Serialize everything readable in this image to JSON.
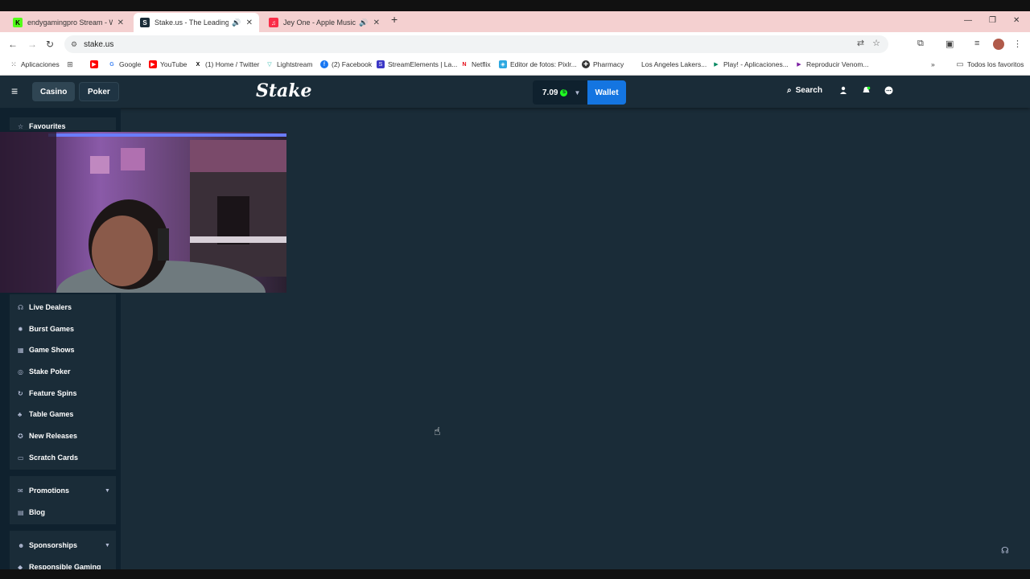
{
  "browser": {
    "tabs": [
      {
        "title": "endygamingpro Stream - Watch",
        "favicon": "kick-logo-icon",
        "color": "#53fc18",
        "glyph": "K",
        "audio": false
      },
      {
        "title": "Stake.us - The Leading Soci",
        "favicon": "stake-logo-icon",
        "color": "#1a2c38",
        "glyph": "S",
        "audio": true
      },
      {
        "title": "Jey One - Apple Music",
        "favicon": "apple-music-icon",
        "color": "#fa2d48",
        "glyph": "♫",
        "audio": true
      }
    ],
    "url": "stake.us",
    "bookmarks": [
      {
        "label": "Aplicaciones",
        "icon": "apps-grid-icon",
        "color": "#555"
      },
      {
        "label": "",
        "icon": "grid-icon",
        "color": "#555"
      },
      {
        "label": "",
        "icon": "youtube-icon",
        "color": "#ff0000"
      },
      {
        "label": "Google",
        "icon": "google-icon",
        "color": "#4285f4"
      },
      {
        "label": "YouTube",
        "icon": "youtube-icon",
        "color": "#ff0000"
      },
      {
        "label": "(1) Home / Twitter",
        "icon": "x-icon",
        "color": "#000"
      },
      {
        "label": "Lightstream",
        "icon": "lightstream-icon",
        "color": "#2ab7a9"
      },
      {
        "label": "(2) Facebook",
        "icon": "facebook-icon",
        "color": "#1877f2"
      },
      {
        "label": "StreamElements | La...",
        "icon": "streamelements-icon",
        "color": "#3d38c6"
      },
      {
        "label": "Netflix",
        "icon": "netflix-icon",
        "color": "#e50914"
      },
      {
        "label": "Editor de fotos: Pixlr...",
        "icon": "pixlr-icon",
        "color": "#2da8e0"
      },
      {
        "label": "Pharmacy",
        "icon": "pharmacy-icon",
        "color": "#333"
      },
      {
        "label": "Los Angeles Lakers...",
        "icon": "lakers-icon",
        "color": "#552583"
      },
      {
        "label": "Play! - Aplicaciones...",
        "icon": "google-play-icon",
        "color": "#01875f"
      },
      {
        "label": "Reproducir Venom...",
        "icon": "play-icon",
        "color": "#7b1fa2"
      }
    ],
    "all_bookmarks": "Todos los favoritos"
  },
  "header": {
    "casino": "Casino",
    "poker": "Poker",
    "logo": "Stake",
    "balance": "7.09",
    "coin": "S",
    "wallet": "Wallet",
    "search": "Search"
  },
  "sidebar": {
    "favourites": "Favourites",
    "items": [
      {
        "label": "Live Dealers",
        "icon": "live-dealer-icon",
        "glyph": "☊"
      },
      {
        "label": "Burst Games",
        "icon": "burst-icon",
        "glyph": "✹"
      },
      {
        "label": "Game Shows",
        "icon": "game-show-icon",
        "glyph": "▦"
      },
      {
        "label": "Stake Poker",
        "icon": "poker-chip-icon",
        "glyph": "◎"
      },
      {
        "label": "Feature Spins",
        "icon": "spins-icon",
        "glyph": "↻"
      },
      {
        "label": "Table Games",
        "icon": "table-games-icon",
        "glyph": "♣"
      },
      {
        "label": "New Releases",
        "icon": "new-releases-icon",
        "glyph": "✪"
      },
      {
        "label": "Scratch Cards",
        "icon": "scratch-card-icon",
        "glyph": "▭"
      }
    ],
    "promotions": "Promotions",
    "blog": "Blog",
    "sponsorships": "Sponsorships",
    "responsible": "Responsible Gaming"
  }
}
